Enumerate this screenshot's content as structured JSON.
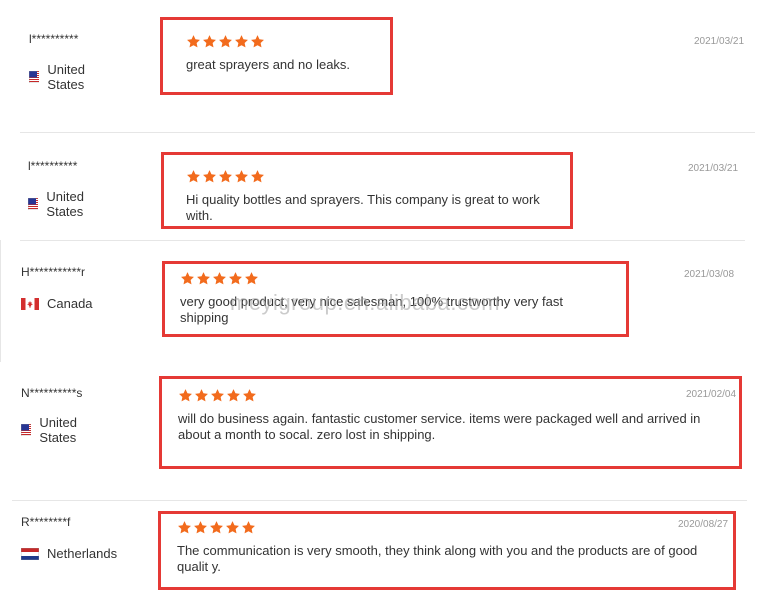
{
  "watermark": "meyigroup.en.alibaba.com",
  "colors": {
    "star": "#f26b1d",
    "highlight_box": "#e53935",
    "date": "#999999"
  },
  "reviews": [
    {
      "user": "l**********",
      "country": "United States",
      "flag": "us-flag",
      "date": "2021/03/21",
      "rating": 5,
      "text": "great sprayers and no leaks."
    },
    {
      "user": "l**********",
      "country": "United States",
      "flag": "us-flag",
      "date": "2021/03/21",
      "rating": 5,
      "text": "Hi quality bottles and sprayers. This company is great to work with."
    },
    {
      "user": "H***********r",
      "country": "Canada",
      "flag": "ca-flag",
      "date": "2021/03/08",
      "rating": 5,
      "text": "very good product, very nice salesman, 100% trustworthy very fast shipping"
    },
    {
      "user": "N**********s",
      "country": "United States",
      "flag": "us-flag",
      "date": "2021/02/04",
      "rating": 5,
      "text": "will do business again. fantastic customer service. items were packaged well and arrived in about a month to socal. zero lost in shipping."
    },
    {
      "user": "R********f",
      "country": "Netherlands",
      "flag": "nl-flag",
      "date": "2020/08/27",
      "rating": 5,
      "text": "The communication is very smooth, they think along with you and the products are of good qualit y."
    }
  ]
}
